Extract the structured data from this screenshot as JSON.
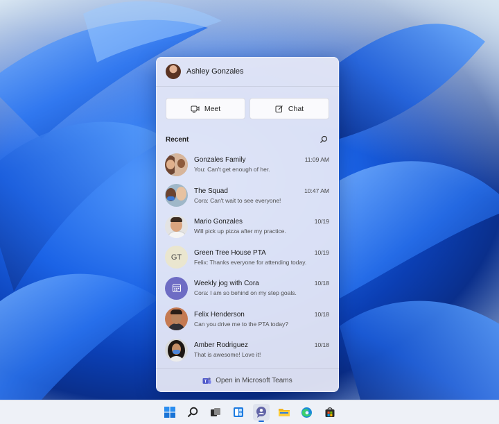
{
  "user": {
    "name": "Ashley Gonzales"
  },
  "actions": {
    "meet_label": "Meet",
    "chat_label": "Chat"
  },
  "recent": {
    "label": "Recent",
    "chats": [
      {
        "name": "Gonzales Family",
        "preview": "You: Can't get enough of her.",
        "time": "11:09 AM",
        "avatar": "group-photo"
      },
      {
        "name": "The Squad",
        "preview": "Cora: Can't wait to see everyone!",
        "time": "10:47 AM",
        "avatar": "group-photo"
      },
      {
        "name": "Mario Gonzales",
        "preview": "Will pick up pizza after my practice.",
        "time": "10/19",
        "avatar": "photo"
      },
      {
        "name": "Green Tree House PTA",
        "preview": "Felix: Thanks everyone for attending today.",
        "time": "10/19",
        "avatar": "initials",
        "initials": "GT"
      },
      {
        "name": "Weekly jog with Cora",
        "preview": "Cora: I am so behind on my step goals.",
        "time": "10/18",
        "avatar": "calendar-icon"
      },
      {
        "name": "Felix Henderson",
        "preview": "Can you drive me to the PTA today?",
        "time": "10/18",
        "avatar": "photo"
      },
      {
        "name": "Amber Rodriguez",
        "preview": "That is awesome! Love it!",
        "time": "10/18",
        "avatar": "photo"
      }
    ]
  },
  "footer": {
    "label": "Open in Microsoft Teams"
  },
  "taskbar": {
    "items": [
      "windows-start-icon",
      "search-icon",
      "task-view-icon",
      "widgets-icon",
      "teams-chat-icon",
      "file-explorer-icon",
      "edge-icon",
      "store-icon"
    ],
    "active": "teams-chat-icon"
  },
  "colors": {
    "accent": "#1b6ad8",
    "teams_purple": "#6264a7"
  }
}
